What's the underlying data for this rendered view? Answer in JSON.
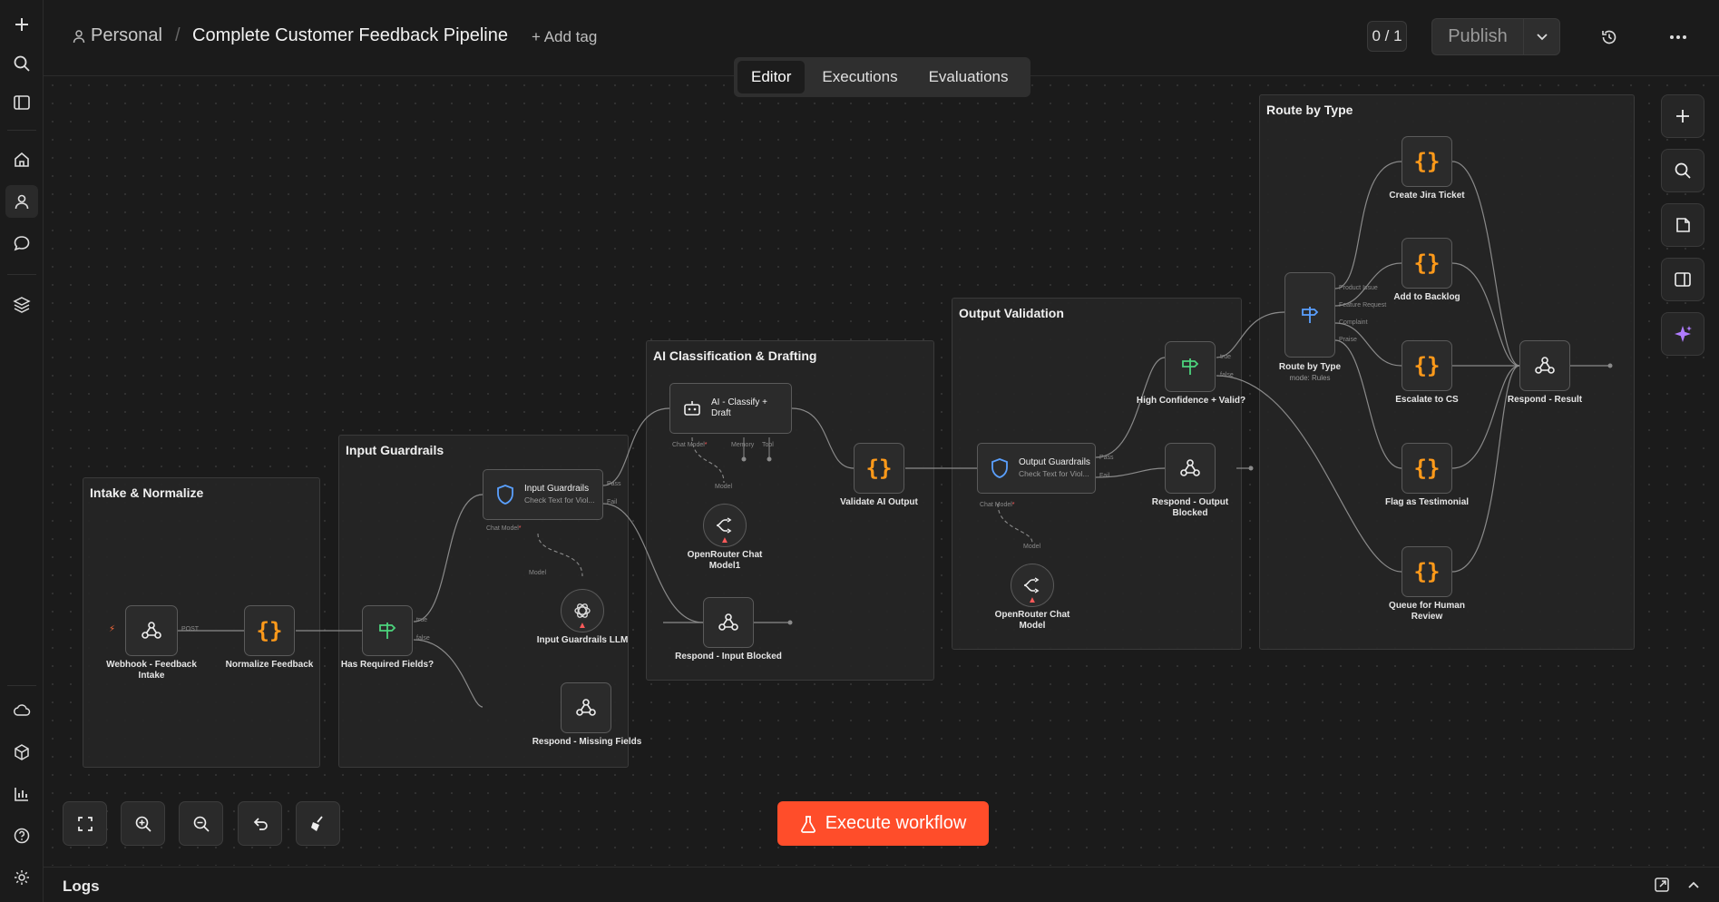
{
  "colors": {
    "execute_bg": "#ff4d2a",
    "code_icon": "#ff9a1a",
    "if_icon": "#4cd47c",
    "switch_icon": "#5aa0ff",
    "guardrails_icon": "#5aa0ff",
    "warning": "#ff5a5a",
    "ai_assistant_icon": "#b07cff"
  },
  "header": {
    "owner_icon": "user-icon",
    "owner": "Personal",
    "separator": "/",
    "workflow_name": "Complete Customer Feedback Pipeline",
    "add_tag": "+ Add tag",
    "counter": "0 / 1",
    "publish": "Publish"
  },
  "tabs": [
    "Editor",
    "Executions",
    "Evaluations"
  ],
  "left_rail": {
    "top": [
      "plus-icon",
      "search-icon",
      "sidebar-toggle-icon"
    ],
    "middle": [
      "home-icon",
      "user-icon",
      "chat-icon"
    ],
    "layers": "layers-icon",
    "bottom": [
      "cloud-icon",
      "package-icon",
      "chart-icon",
      "help-icon",
      "settings-icon"
    ]
  },
  "groups": [
    {
      "title": "Intake & Normalize"
    },
    {
      "title": "Input Guardrails"
    },
    {
      "title": "AI Classification & Drafting"
    },
    {
      "title": "Output Validation"
    },
    {
      "title": "Route by Type"
    }
  ],
  "nodes": {
    "webhook": {
      "label": "Webhook - Feedback Intake",
      "port": "POST"
    },
    "normalize": {
      "label": "Normalize Feedback"
    },
    "has_required": {
      "label": "Has Required Fields?",
      "true": "true",
      "false": "false"
    },
    "input_guardrails": {
      "title": "Input Guardrails",
      "sub": "Check Text for Viol...",
      "pass": "Pass",
      "fail": "Fail",
      "chat_model": "Chat Model",
      "required": "*"
    },
    "input_llm": {
      "label": "Input Guardrails LLM",
      "port": "Model"
    },
    "respond_missing": {
      "label": "Respond - Missing Fields"
    },
    "ai_classify": {
      "title": "AI - Classify + Draft",
      "chat_model": "Chat Model",
      "memory": "Memory",
      "tool": "Tool",
      "required": "*"
    },
    "openrouter1": {
      "label": "OpenRouter Chat Model1",
      "port": "Model"
    },
    "respond_input_blocked": {
      "label": "Respond - Input Blocked"
    },
    "validate": {
      "label": "Validate AI Output"
    },
    "output_guardrails": {
      "title": "Output Guardrails",
      "sub": "Check Text for Viol...",
      "pass": "Pass",
      "fail": "Fail",
      "chat_model": "Chat Model",
      "required": "*"
    },
    "openrouter": {
      "label": "OpenRouter Chat Model",
      "port": "Model"
    },
    "high_conf": {
      "label": "High Confidence + Valid?",
      "true": "true",
      "false": "false"
    },
    "respond_output_blocked": {
      "label": "Respond - Output Blocked"
    },
    "route": {
      "label": "Route by Type",
      "sub": "mode: Rules",
      "outputs": [
        "Product Issue",
        "Feature Request",
        "Complaint",
        "Praise"
      ]
    },
    "jira": {
      "label": "Create Jira Ticket"
    },
    "backlog": {
      "label": "Add to Backlog"
    },
    "escalate": {
      "label": "Escalate to CS"
    },
    "testimonial": {
      "label": "Flag as Testimonial"
    },
    "queue": {
      "label": "Queue for Human Review"
    },
    "respond_result": {
      "label": "Respond - Result"
    }
  },
  "side_tools": [
    "plus-icon",
    "search-icon",
    "sticky-note-icon",
    "panel-icon",
    "sparkle-icon"
  ],
  "bottom_tools": [
    "fit-view-icon",
    "zoom-in-icon",
    "zoom-out-icon",
    "undo-icon",
    "clear-icon"
  ],
  "execute_button": "Execute workflow",
  "logs": {
    "title": "Logs"
  }
}
